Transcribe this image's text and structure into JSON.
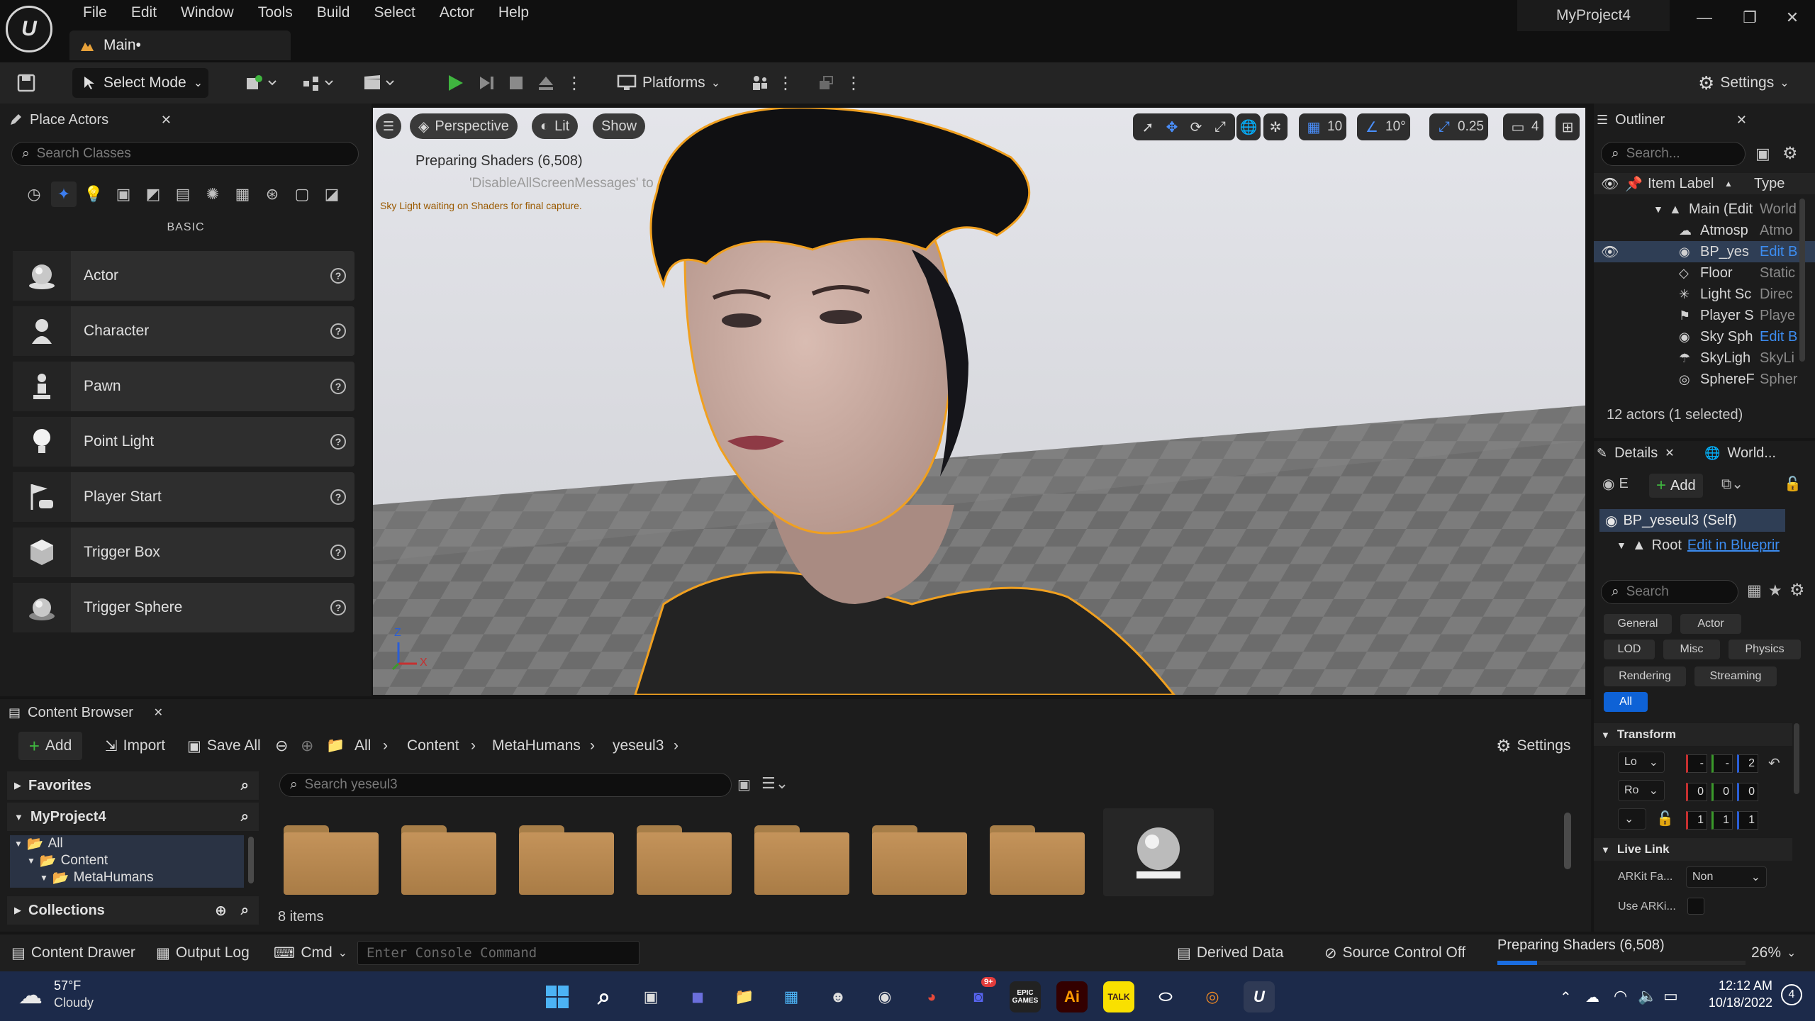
{
  "window": {
    "menu": [
      "File",
      "Edit",
      "Window",
      "Tools",
      "Build",
      "Select",
      "Actor",
      "Help"
    ],
    "doc_tab": "Main•",
    "project_name": "MyProject4",
    "min_glyph": "—",
    "max_glyph": "❐",
    "close_glyph": "✕"
  },
  "toolbar": {
    "select_mode": "Select Mode",
    "platforms": "Platforms",
    "settings": "Settings"
  },
  "place_actors": {
    "tab_label": "Place Actors",
    "search_placeholder": "Search Classes",
    "category_label": "BASIC",
    "items": [
      {
        "label": "Actor",
        "icon": "sphere-icon"
      },
      {
        "label": "Character",
        "icon": "character-icon"
      },
      {
        "label": "Pawn",
        "icon": "pawn-icon"
      },
      {
        "label": "Point Light",
        "icon": "point-light-icon"
      },
      {
        "label": "Player Start",
        "icon": "player-start-icon"
      },
      {
        "label": "Trigger Box",
        "icon": "trigger-box-icon"
      },
      {
        "label": "Trigger Sphere",
        "icon": "trigger-sphere-icon"
      }
    ]
  },
  "viewport": {
    "perspective": "Perspective",
    "lit": "Lit",
    "show": "Show",
    "grid_snap": "10",
    "rot_snap": "10°",
    "scale_snap": "0.25",
    "camera_speed": "4",
    "shader_msg": "Preparing Shaders (6,508)",
    "shader_msg2": "'DisableAllScreenMessages' to",
    "skylight_msg": "Sky Light waiting on Shaders for final capture.",
    "axis_z": "Z",
    "axis_x": "X"
  },
  "outliner": {
    "tab_label": "Outliner",
    "search_placeholder": "Search...",
    "col_label": "Item Label",
    "col_type": "Type",
    "rows": [
      {
        "label": "Main (Edit",
        "type": "World",
        "indent": 0
      },
      {
        "label": "Atmosp",
        "type": "Atmo",
        "indent": 1
      },
      {
        "label": "BP_yes",
        "type": "Edit B",
        "indent": 1,
        "selected": true,
        "link": true
      },
      {
        "label": "Floor",
        "type": "Static",
        "indent": 1
      },
      {
        "label": "Light Sc",
        "type": "Direc",
        "indent": 1
      },
      {
        "label": "Player S",
        "type": "Playe",
        "indent": 1
      },
      {
        "label": "Sky Sph",
        "type": "Edit B",
        "indent": 1,
        "link": true
      },
      {
        "label": "SkyLigh",
        "type": "SkyLi",
        "indent": 1
      },
      {
        "label": "SphereF",
        "type": "Spher",
        "indent": 1
      }
    ],
    "status": "12 actors (1 selected)"
  },
  "details": {
    "tab_label": "Details",
    "tab2_label": "World...",
    "add_label": "Add",
    "e_label": "E",
    "component_self": "BP_yeseul3 (Self)",
    "component_root": "Root",
    "edit_in_blueprint": "Edit in Blueprir",
    "search_placeholder": "Search",
    "filters": [
      "General",
      "Actor",
      "LOD",
      "Misc",
      "Physics",
      "Rendering",
      "Streaming",
      "All"
    ],
    "transform_label": "Transform",
    "loc_label": "Lo",
    "rot_label": "Ro",
    "loc_values": [
      "-",
      "-",
      "2"
    ],
    "rot_values": [
      "0",
      "0",
      "0"
    ],
    "scale_values": [
      "1",
      "1",
      "1"
    ],
    "livelink_label": "Live Link",
    "arkit_label": "ARKit Fa...",
    "arkit_value": "Non",
    "use_arkit_label": "Use ARKi..."
  },
  "content_browser": {
    "tab_label": "Content Browser",
    "add": "Add",
    "import": "Import",
    "save_all": "Save All",
    "crumbs": [
      "All",
      "Content",
      "MetaHumans",
      "yeseul3"
    ],
    "settings": "Settings",
    "favorites": "Favorites",
    "project": "MyProject4",
    "tree": [
      "All",
      "Content",
      "MetaHumans"
    ],
    "collections": "Collections",
    "search_placeholder": "Search yeseul3",
    "item_count": "8 items"
  },
  "statusbar": {
    "content_drawer": "Content Drawer",
    "output_log": "Output Log",
    "cmd": "Cmd",
    "console_placeholder": "Enter Console Command",
    "derived_data": "Derived Data",
    "source_control": "Source Control Off",
    "preparing": "Preparing Shaders (6,508)",
    "progress_fraction": 0.16,
    "percent": "26%"
  },
  "taskbar": {
    "weather_temp": "57°F",
    "weather_desc": "Cloudy",
    "time": "12:12 AM",
    "date": "10/18/2022",
    "notif_count": "4",
    "discord_badge": "9+",
    "epic_label": "EPIC\nGAMES",
    "ai_label": "Ai",
    "talk_label": "TALK"
  },
  "colors": {
    "accent": "#3c7ef0",
    "selection_outline": "#f0a020",
    "play_green": "#3fb53f"
  }
}
